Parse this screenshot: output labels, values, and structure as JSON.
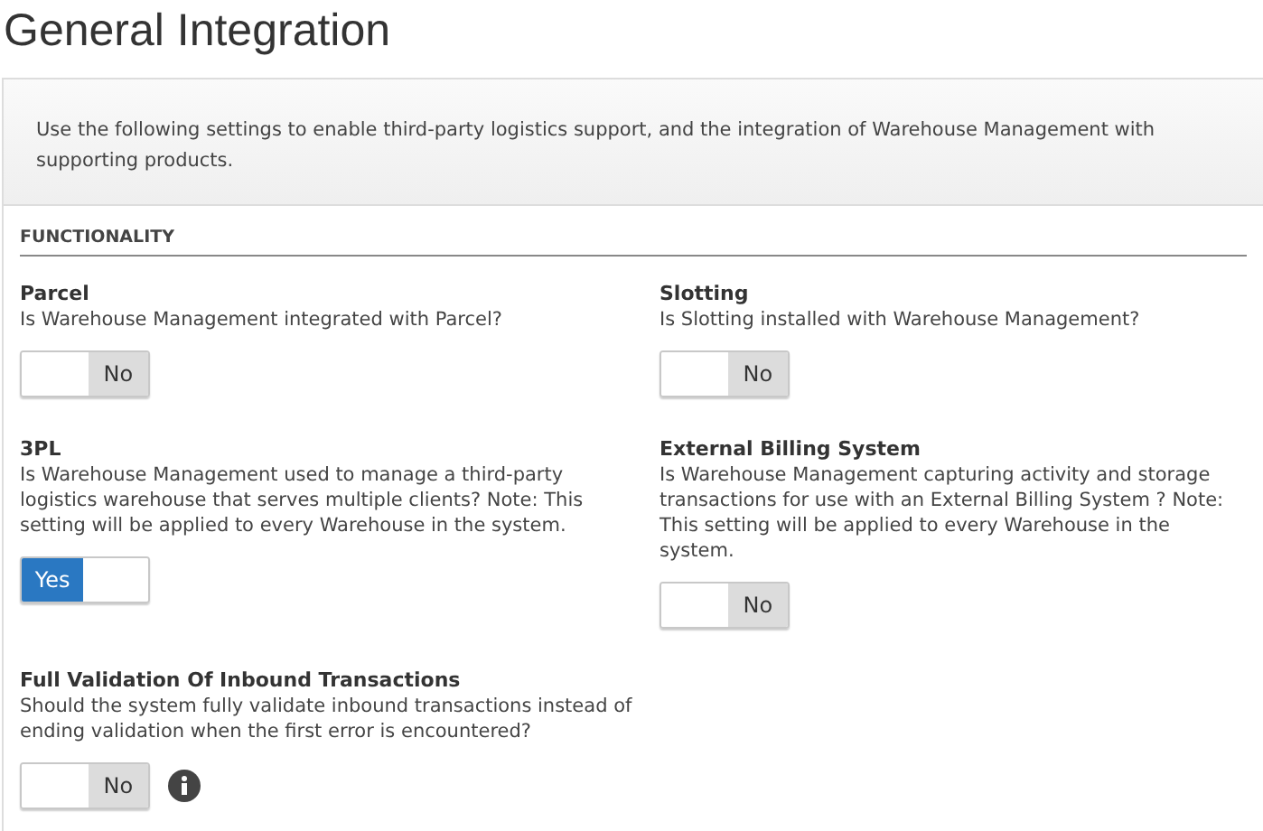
{
  "title": "General Integration",
  "intro": "Use the following settings to enable third-party logistics support, and the integration of Warehouse Management with supporting products.",
  "section": "FUNCTIONALITY",
  "settings": [
    {
      "name": "Parcel",
      "description": "Is Warehouse Management integrated with Parcel?",
      "on": false,
      "toggle_label": "No",
      "info": false
    },
    {
      "name": "Slotting",
      "description": "Is Slotting installed with Warehouse Management?",
      "on": false,
      "toggle_label": "No",
      "info": false
    },
    {
      "name": "3PL",
      "description": "Is Warehouse Management used to manage a third-party logistics warehouse that serves multiple clients? Note: This setting will be applied to every Warehouse in the system.",
      "on": true,
      "toggle_label": "Yes",
      "info": false
    },
    {
      "name": "External Billing System",
      "description": "Is Warehouse Management capturing activity and storage transactions for use with an External Billing System ? Note: This setting will be applied to every Warehouse in the system.",
      "on": false,
      "toggle_label": "No",
      "info": false
    },
    {
      "name": "Full Validation Of Inbound Transactions",
      "description": "Should the system fully validate inbound transactions instead of ending validation when the first error is encountered?",
      "on": false,
      "toggle_label": "No",
      "info": true
    }
  ]
}
